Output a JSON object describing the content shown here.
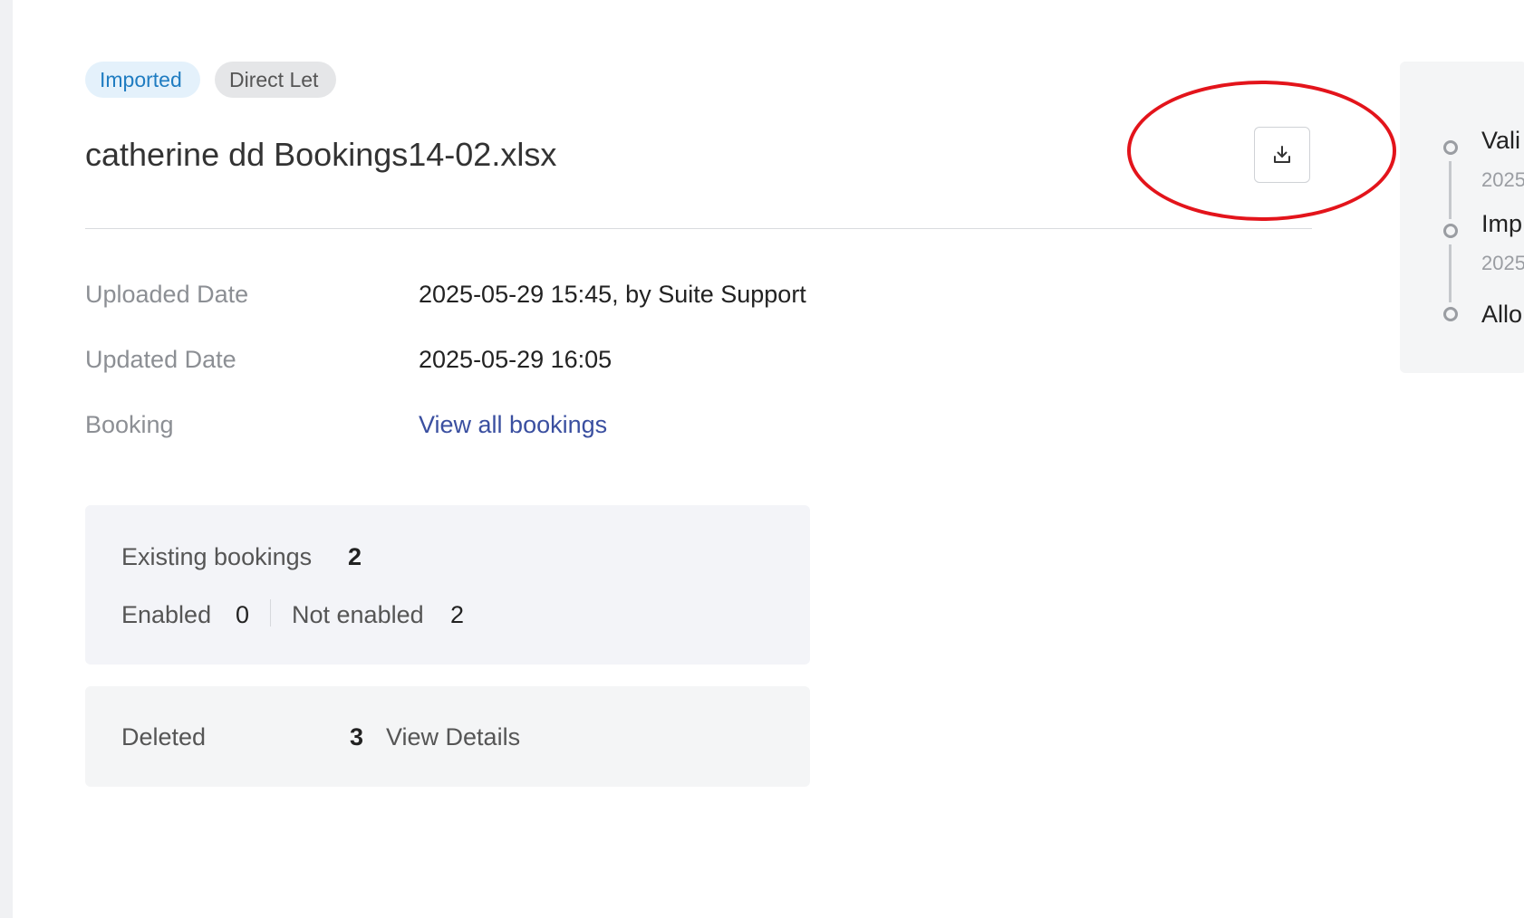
{
  "tags": {
    "status": "Imported",
    "type": "Direct Let"
  },
  "file": {
    "title": "catherine dd Bookings14-02.xlsx"
  },
  "details": {
    "uploaded_label": "Uploaded Date",
    "uploaded_value": "2025-05-29 15:45, by Suite Support",
    "updated_label": "Updated Date",
    "updated_value": "2025-05-29 16:05",
    "booking_label": "Booking",
    "booking_link": "View all bookings"
  },
  "existing": {
    "label": "Existing bookings",
    "count": "2",
    "enabled_label": "Enabled",
    "enabled_count": "0",
    "not_enabled_label": "Not enabled",
    "not_enabled_count": "2"
  },
  "deleted": {
    "label": "Deleted",
    "count": "3",
    "link": "View Details"
  },
  "timeline": {
    "steps": [
      {
        "title": "Vali",
        "date": "2025"
      },
      {
        "title": "Imp",
        "date": "2025"
      },
      {
        "title": "Allo",
        "date": ""
      }
    ]
  },
  "icons": {
    "download": "download-icon"
  },
  "colors": {
    "accent_link": "#3a4fa0",
    "imported_tag_bg": "#e4f1fb",
    "imported_tag_text": "#1f7cc1",
    "annotation_red": "#e3141b"
  }
}
